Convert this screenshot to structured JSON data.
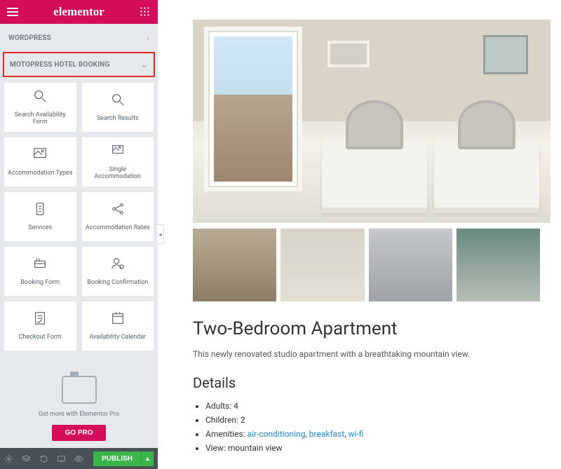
{
  "header": {
    "brand": "elementor"
  },
  "accordion": {
    "wordpress": "WORDPRESS",
    "motopress": "MOTOPRESS HOTEL BOOKING"
  },
  "widgets": [
    {
      "label": "Search Availability Form",
      "icon": "search-icon"
    },
    {
      "label": "Search Results",
      "icon": "search-icon"
    },
    {
      "label": "Accommodation Types",
      "icon": "gallery-icon"
    },
    {
      "label": "Single Accommodation",
      "icon": "image-icon"
    },
    {
      "label": "Services",
      "icon": "list-icon"
    },
    {
      "label": "Accommodation Rates",
      "icon": "share-icon"
    },
    {
      "label": "Booking Form",
      "icon": "form-icon"
    },
    {
      "label": "Booking Confirmation",
      "icon": "user-check-icon"
    },
    {
      "label": "Checkout Form",
      "icon": "form-check-icon"
    },
    {
      "label": "Availability Calendar",
      "icon": "calendar-icon"
    }
  ],
  "promo": {
    "caption": "Get more with Elementor Pro",
    "cta": "GO PRO"
  },
  "bottombar": {
    "publish": "PUBLISH"
  },
  "content": {
    "title": "Two-Bedroom Apartment",
    "description": "This newly renovated studio apartment with a breathtaking mountain view.",
    "details_heading": "Details",
    "adults_label": "Adults:",
    "adults_value": "4",
    "children_label": "Children:",
    "children_value": "2",
    "amenities_label": "Amenities:",
    "amenity1": "air-conditioning",
    "amenity2": "breakfast",
    "amenity3": "wi-fi",
    "view_label": "View:",
    "view_value": "mountain view"
  }
}
